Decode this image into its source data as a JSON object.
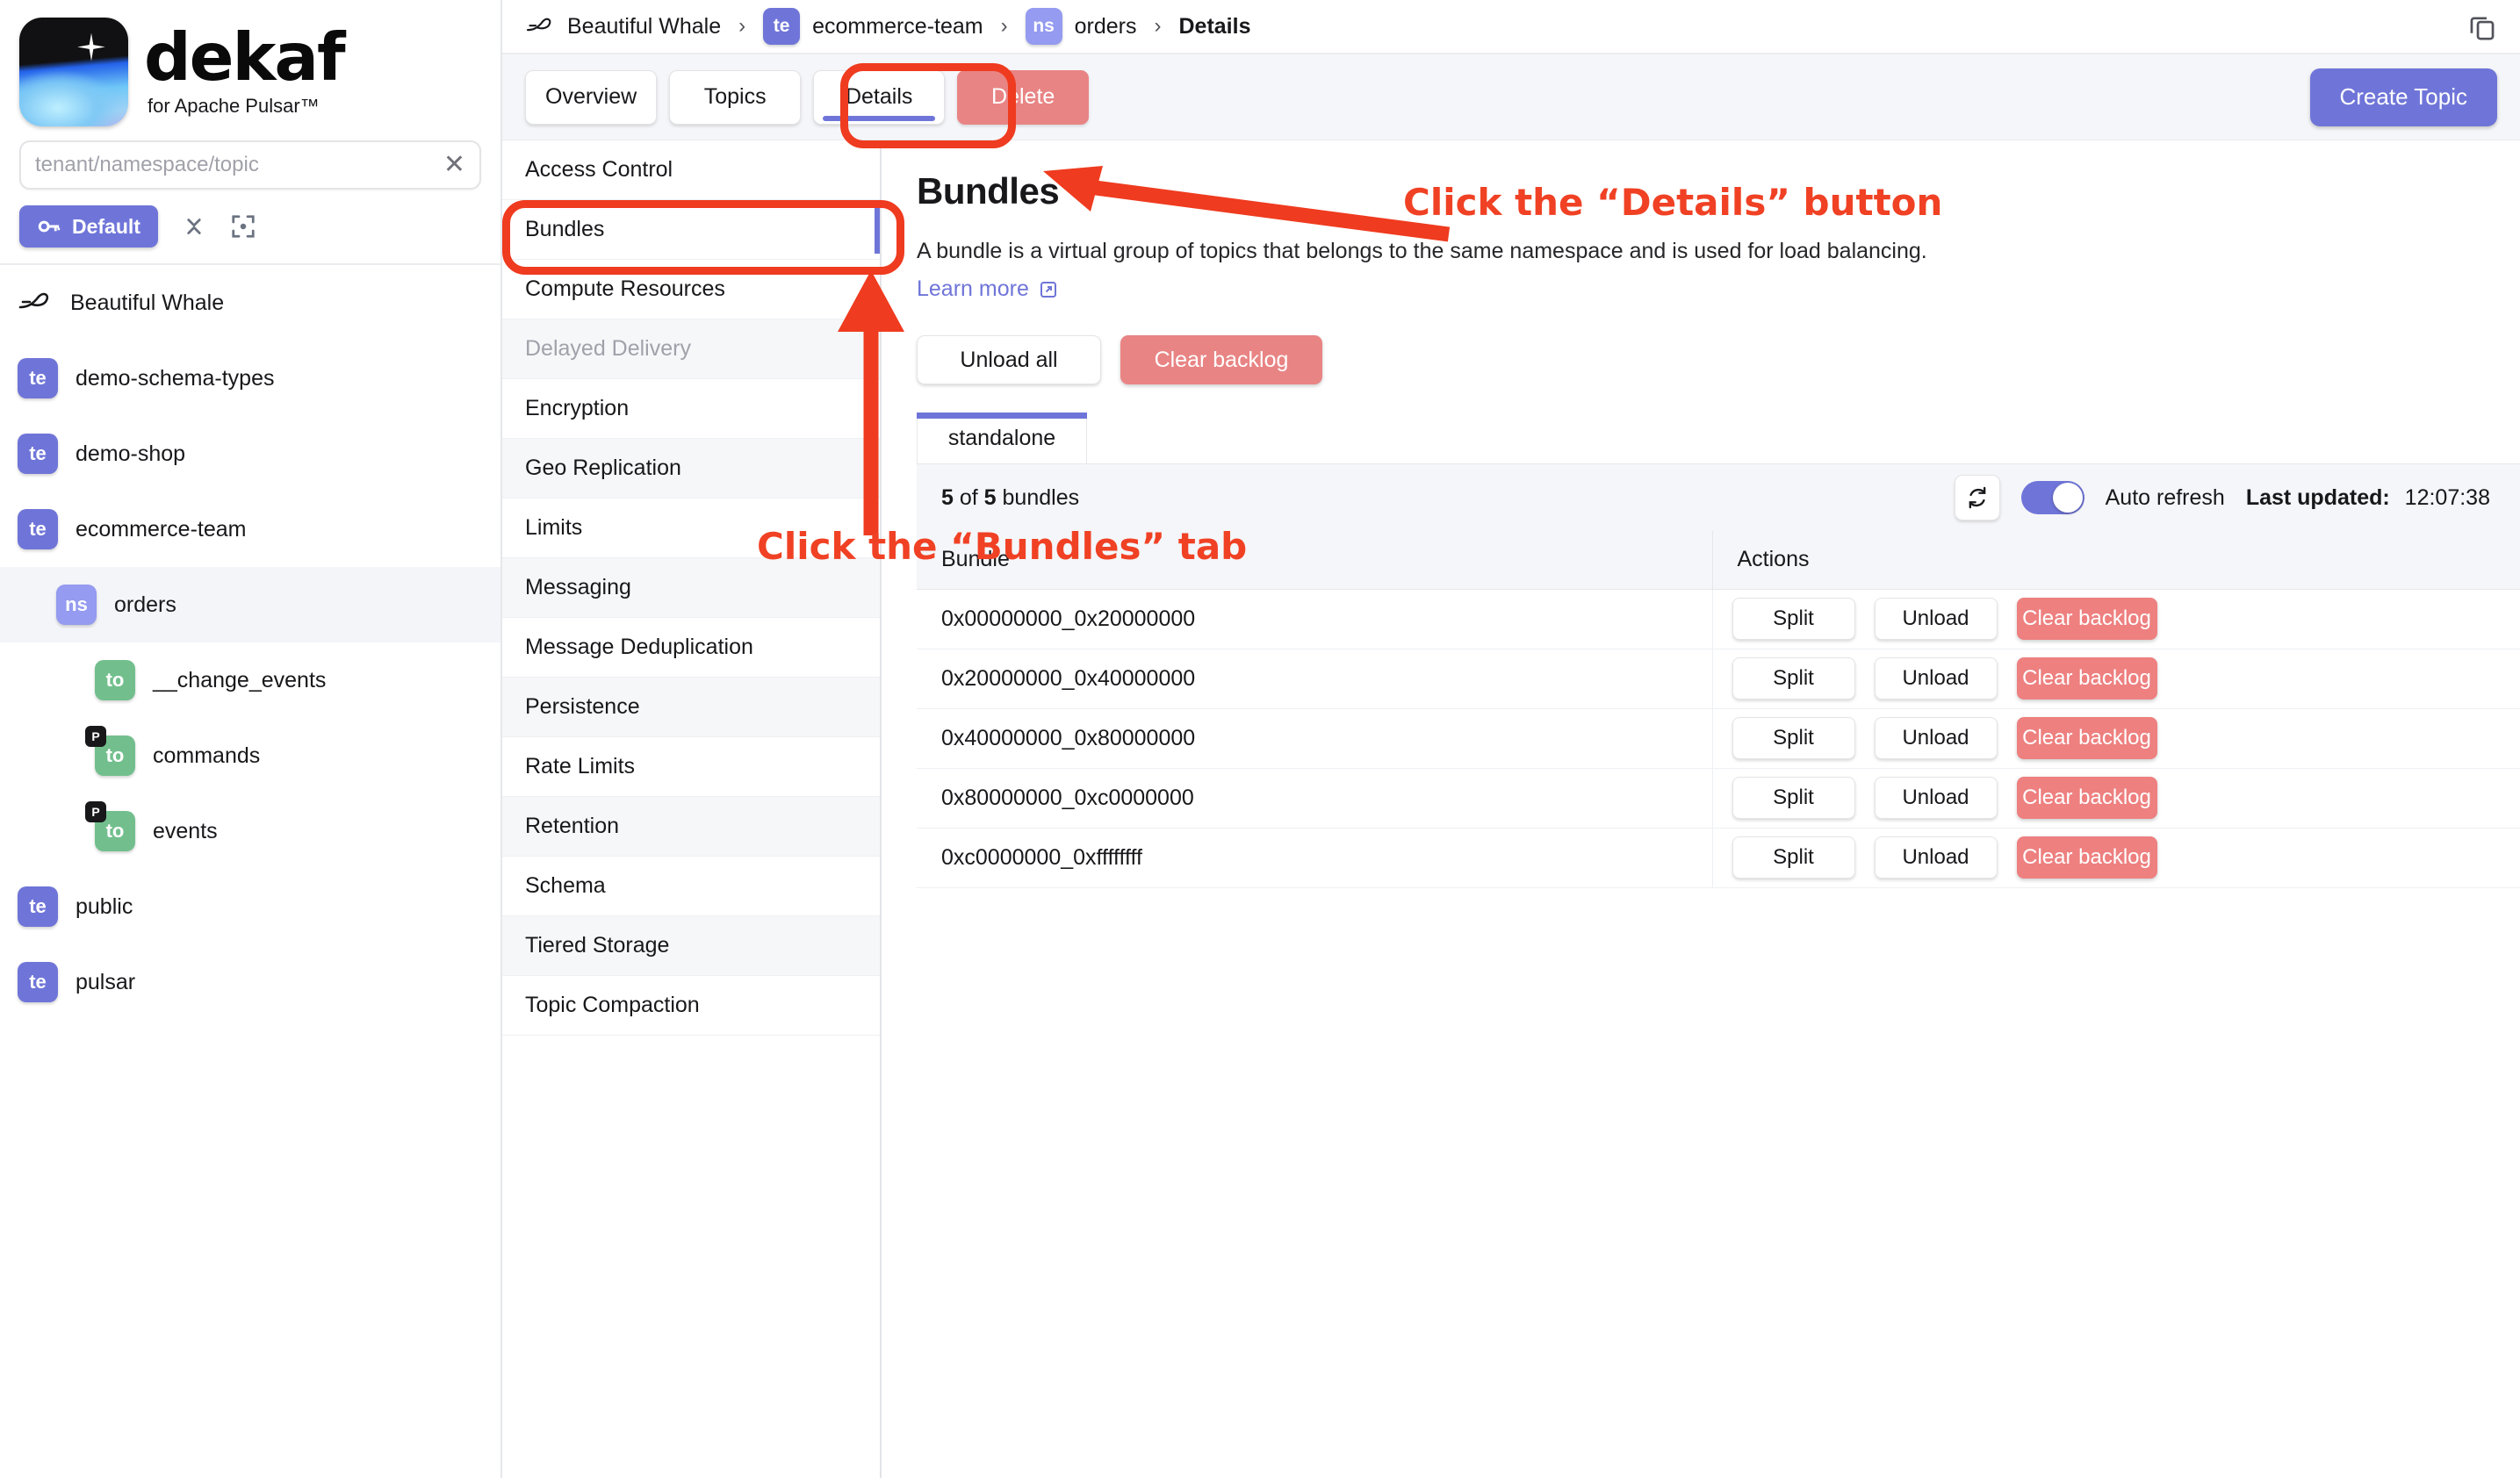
{
  "brand": {
    "name": "dekaf",
    "tagline": "for Apache Pulsar™",
    "logo_icon": "dekaf-logo-icon"
  },
  "search": {
    "placeholder": "tenant/namespace/topic",
    "value": "",
    "clear_icon": "close-icon"
  },
  "auth": {
    "key_label": "Default",
    "key_icon": "key-icon",
    "collapse_icon": "collapse-icon",
    "focus_icon": "focus-icon"
  },
  "sidebar": {
    "cluster": {
      "label": "Beautiful Whale",
      "icon": "whale-icon"
    },
    "items": [
      {
        "label": "demo-schema-types",
        "tag": "te",
        "level": 0,
        "selected": false,
        "pinned": false
      },
      {
        "label": "demo-shop",
        "tag": "te",
        "level": 0,
        "selected": false,
        "pinned": false
      },
      {
        "label": "ecommerce-team",
        "tag": "te",
        "level": 0,
        "selected": false,
        "pinned": false
      },
      {
        "label": "orders",
        "tag": "ns",
        "level": 1,
        "selected": true,
        "pinned": false
      },
      {
        "label": "__change_events",
        "tag": "to",
        "level": 2,
        "selected": false,
        "pinned": false
      },
      {
        "label": "commands",
        "tag": "to",
        "level": 2,
        "selected": false,
        "pinned": true
      },
      {
        "label": "events",
        "tag": "to",
        "level": 2,
        "selected": false,
        "pinned": true
      },
      {
        "label": "public",
        "tag": "te",
        "level": 0,
        "selected": false,
        "pinned": false
      },
      {
        "label": "pulsar",
        "tag": "te",
        "level": 0,
        "selected": false,
        "pinned": false
      }
    ]
  },
  "breadcrumb": {
    "cluster": "Beautiful Whale",
    "tenant": "ecommerce-team",
    "tenant_tag": "te",
    "namespace": "orders",
    "namespace_tag": "ns",
    "current": "Details",
    "separator": "›",
    "copy_icon": "copy-icon"
  },
  "tabs": {
    "items": [
      {
        "label": "Overview",
        "active": false,
        "danger": false
      },
      {
        "label": "Topics",
        "active": false,
        "danger": false
      },
      {
        "label": "Details",
        "active": true,
        "danger": false
      },
      {
        "label": "Delete",
        "active": false,
        "danger": true
      }
    ],
    "create_label": "Create Topic"
  },
  "settings_nav": [
    {
      "label": "Access Control",
      "selected": false,
      "disabled": false
    },
    {
      "label": "Bundles",
      "selected": true,
      "disabled": false
    },
    {
      "label": "Compute Resources",
      "selected": false,
      "disabled": false
    },
    {
      "label": "Delayed Delivery",
      "selected": false,
      "disabled": true
    },
    {
      "label": "Encryption",
      "selected": false,
      "disabled": false
    },
    {
      "label": "Geo Replication",
      "selected": false,
      "disabled": false
    },
    {
      "label": "Limits",
      "selected": false,
      "disabled": false
    },
    {
      "label": "Messaging",
      "selected": false,
      "disabled": false
    },
    {
      "label": "Message Deduplication",
      "selected": false,
      "disabled": false
    },
    {
      "label": "Persistence",
      "selected": false,
      "disabled": false
    },
    {
      "label": "Rate Limits",
      "selected": false,
      "disabled": false
    },
    {
      "label": "Retention",
      "selected": false,
      "disabled": false
    },
    {
      "label": "Schema",
      "selected": false,
      "disabled": false
    },
    {
      "label": "Tiered Storage",
      "selected": false,
      "disabled": false
    },
    {
      "label": "Topic Compaction",
      "selected": false,
      "disabled": false
    }
  ],
  "page": {
    "title": "Bundles",
    "description": "A bundle is a virtual group of topics that belongs to the same namespace and is used for load balancing.",
    "learn_more": "Learn more",
    "learn_more_icon": "external-link-icon",
    "unload_all_label": "Unload all",
    "clear_backlog_label": "Clear backlog"
  },
  "cluster_tabs": [
    {
      "label": "standalone",
      "active": true
    }
  ],
  "panel": {
    "count_prefix": "5",
    "count_middle": "of",
    "count_total": "5",
    "count_suffix": "bundles",
    "refresh_icon": "refresh-icon",
    "auto_refresh_label": "Auto refresh",
    "auto_refresh_on": true,
    "last_updated_label": "Last updated:",
    "last_updated_value": "12:07:38"
  },
  "table": {
    "columns": [
      "Bundle",
      "Actions"
    ],
    "action_labels": {
      "split": "Split",
      "unload": "Unload",
      "clear": "Clear backlog"
    },
    "rows": [
      {
        "bundle": "0x00000000_0x20000000"
      },
      {
        "bundle": "0x20000000_0x40000000"
      },
      {
        "bundle": "0x40000000_0x80000000"
      },
      {
        "bundle": "0x80000000_0xc0000000"
      },
      {
        "bundle": "0xc0000000_0xffffffff"
      }
    ]
  },
  "annotations": {
    "details_hint": "Click the “Details” button",
    "bundles_hint": "Click the “Bundles” tab",
    "color": "#f04124"
  },
  "colors": {
    "accent": "#6f75d8",
    "danger": "#e98484",
    "tag_tenant": "#6f75d8",
    "tag_namespace": "#949bf0",
    "tag_topic": "#72bf8d",
    "annotation": "#ef3b1f"
  }
}
